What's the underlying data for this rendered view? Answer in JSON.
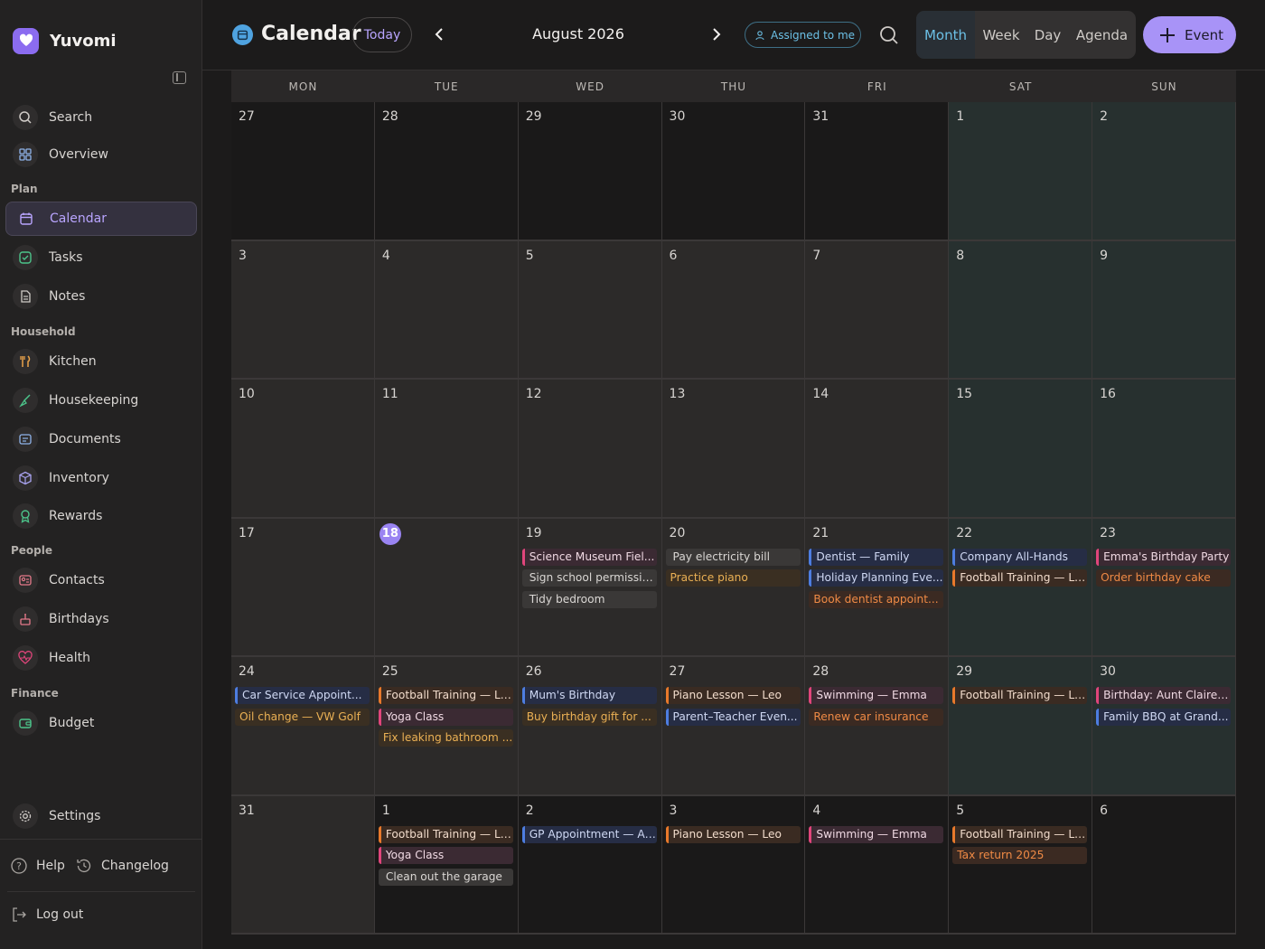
{
  "app": {
    "name": "Yuvomi"
  },
  "sidebar": {
    "top_items": [
      {
        "label": "Search",
        "icon": "search-icon"
      },
      {
        "label": "Overview",
        "icon": "grid-icon"
      }
    ],
    "sections": [
      {
        "title": "Plan",
        "items": [
          {
            "label": "Calendar",
            "icon": "calendar-icon",
            "active": true
          },
          {
            "label": "Tasks",
            "icon": "check-square-icon"
          },
          {
            "label": "Notes",
            "icon": "note-icon"
          }
        ]
      },
      {
        "title": "Household",
        "items": [
          {
            "label": "Kitchen",
            "icon": "utensils-icon"
          },
          {
            "label": "Housekeeping",
            "icon": "broom-icon"
          },
          {
            "label": "Documents",
            "icon": "folder-icon"
          },
          {
            "label": "Inventory",
            "icon": "box-icon"
          },
          {
            "label": "Rewards",
            "icon": "award-icon"
          }
        ]
      },
      {
        "title": "People",
        "items": [
          {
            "label": "Contacts",
            "icon": "contact-card-icon"
          },
          {
            "label": "Birthdays",
            "icon": "cake-icon"
          },
          {
            "label": "Health",
            "icon": "heart-pulse-icon"
          }
        ]
      },
      {
        "title": "Finance",
        "items": [
          {
            "label": "Budget",
            "icon": "wallet-icon"
          }
        ]
      }
    ],
    "settings": "Settings",
    "help": "Help",
    "changelog": "Changelog",
    "logout": "Log out"
  },
  "header": {
    "title": "Calendar",
    "today": "Today",
    "month": "August 2026",
    "assigned_filter": "Assigned to me",
    "views": [
      "Month",
      "Week",
      "Day",
      "Agenda"
    ],
    "active_view": "Month",
    "new_event": "Event"
  },
  "colors": {
    "accent": "#a893f7",
    "event_pink": "#e0457b",
    "event_blue": "#4d7de0",
    "event_orange": "#e8792b",
    "task_gold": "#eab054",
    "weekend_bg": "#27302f"
  },
  "calendar": {
    "weekdays": [
      "MON",
      "TUE",
      "WED",
      "THU",
      "FRI",
      "SAT",
      "SUN"
    ],
    "today": "18",
    "weeks": [
      [
        {
          "day": "27",
          "dim": true,
          "events": []
        },
        {
          "day": "28",
          "dim": true,
          "events": []
        },
        {
          "day": "29",
          "dim": true,
          "events": []
        },
        {
          "day": "30",
          "dim": true,
          "events": []
        },
        {
          "day": "31",
          "dim": true,
          "events": []
        },
        {
          "day": "1",
          "events": []
        },
        {
          "day": "2",
          "events": []
        }
      ],
      [
        {
          "day": "3",
          "events": []
        },
        {
          "day": "4",
          "events": []
        },
        {
          "day": "5",
          "events": []
        },
        {
          "day": "6",
          "events": []
        },
        {
          "day": "7",
          "events": []
        },
        {
          "day": "8",
          "events": []
        },
        {
          "day": "9",
          "events": []
        }
      ],
      [
        {
          "day": "10",
          "events": []
        },
        {
          "day": "11",
          "events": []
        },
        {
          "day": "12",
          "events": []
        },
        {
          "day": "13",
          "events": []
        },
        {
          "day": "14",
          "events": []
        },
        {
          "day": "15",
          "events": []
        },
        {
          "day": "16",
          "events": []
        }
      ],
      [
        {
          "day": "17",
          "events": []
        },
        {
          "day": "18",
          "events": []
        },
        {
          "day": "19",
          "events": [
            {
              "title": "Science Museum Fiel...",
              "kind": "pink"
            },
            {
              "title": "Sign school permissio...",
              "kind": "grey"
            },
            {
              "title": "Tidy bedroom",
              "kind": "grey"
            }
          ]
        },
        {
          "day": "20",
          "events": [
            {
              "title": "Pay electricity bill",
              "kind": "grey"
            },
            {
              "title": "Practice piano",
              "kind": "task-gold"
            }
          ]
        },
        {
          "day": "21",
          "events": [
            {
              "title": "Dentist — Family",
              "kind": "blue"
            },
            {
              "title": "Holiday Planning Eve...",
              "kind": "blue"
            },
            {
              "title": "Book dentist appoint...",
              "kind": "task-orange"
            }
          ]
        },
        {
          "day": "22",
          "events": [
            {
              "title": "Company All-Hands",
              "kind": "blue"
            },
            {
              "title": "Football Training — Leo",
              "kind": "orange"
            }
          ]
        },
        {
          "day": "23",
          "events": [
            {
              "title": "Emma's Birthday Party",
              "kind": "pink"
            },
            {
              "title": "Order birthday cake",
              "kind": "task-orange"
            }
          ]
        }
      ],
      [
        {
          "day": "24",
          "events": [
            {
              "title": "Car Service Appoint...",
              "kind": "blue"
            },
            {
              "title": "Oil change — VW Golf",
              "kind": "task-gold"
            }
          ]
        },
        {
          "day": "25",
          "events": [
            {
              "title": "Football Training — Leo",
              "kind": "orange"
            },
            {
              "title": "Yoga Class",
              "kind": "pink"
            },
            {
              "title": "Fix leaking bathroom ...",
              "kind": "task-gold"
            }
          ]
        },
        {
          "day": "26",
          "events": [
            {
              "title": "Mum's Birthday",
              "kind": "blue"
            },
            {
              "title": "Buy birthday gift for ...",
              "kind": "task-gold"
            }
          ]
        },
        {
          "day": "27",
          "events": [
            {
              "title": "Piano Lesson — Leo",
              "kind": "orange"
            },
            {
              "title": "Parent–Teacher Even...",
              "kind": "blue"
            }
          ]
        },
        {
          "day": "28",
          "events": [
            {
              "title": "Swimming — Emma",
              "kind": "pink"
            },
            {
              "title": "Renew car insurance",
              "kind": "task-orange"
            }
          ]
        },
        {
          "day": "29",
          "events": [
            {
              "title": "Football Training — Leo",
              "kind": "orange"
            }
          ]
        },
        {
          "day": "30",
          "events": [
            {
              "title": "Birthday: Aunt Claire ...",
              "kind": "pink"
            },
            {
              "title": "Family BBQ at Grand...",
              "kind": "blue"
            }
          ]
        }
      ],
      [
        {
          "day": "31",
          "events": []
        },
        {
          "day": "1",
          "dim": true,
          "events": [
            {
              "title": "Football Training — Leo",
              "kind": "orange"
            },
            {
              "title": "Yoga Class",
              "kind": "pink"
            },
            {
              "title": "Clean out the garage",
              "kind": "grey"
            }
          ]
        },
        {
          "day": "2",
          "dim": true,
          "events": [
            {
              "title": "GP Appointment — Al...",
              "kind": "blue"
            }
          ]
        },
        {
          "day": "3",
          "dim": true,
          "events": [
            {
              "title": "Piano Lesson — Leo",
              "kind": "orange"
            }
          ]
        },
        {
          "day": "4",
          "dim": true,
          "events": [
            {
              "title": "Swimming — Emma",
              "kind": "pink"
            }
          ]
        },
        {
          "day": "5",
          "dim": true,
          "events": [
            {
              "title": "Football Training — Leo",
              "kind": "orange"
            },
            {
              "title": "Tax return 2025",
              "kind": "task-orange"
            }
          ]
        },
        {
          "day": "6",
          "dim": true,
          "events": []
        }
      ]
    ]
  }
}
